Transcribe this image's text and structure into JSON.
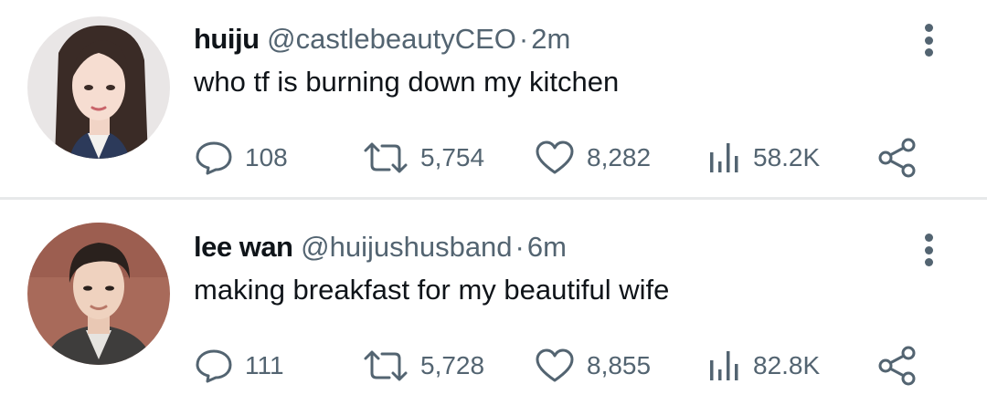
{
  "tweets": [
    {
      "display_name": "huiju",
      "handle": "@castlebeautyCEO",
      "separator": "·",
      "time": "2m",
      "text": "who tf is burning down my kitchen",
      "replies": "108",
      "retweets": "5,754",
      "likes": "8,282",
      "views": "58.2K",
      "avatar": "woman-portrait"
    },
    {
      "display_name": "lee wan",
      "handle": "@huijushusband",
      "separator": "·",
      "time": "6m",
      "text": "making breakfast for my beautiful wife",
      "replies": "111",
      "retweets": "5,728",
      "likes": "8,855",
      "views": "82.8K",
      "avatar": "man-portrait"
    }
  ],
  "colors": {
    "primary_text": "#0f1419",
    "secondary_text": "#536471",
    "divider": "#e7e9ea"
  }
}
